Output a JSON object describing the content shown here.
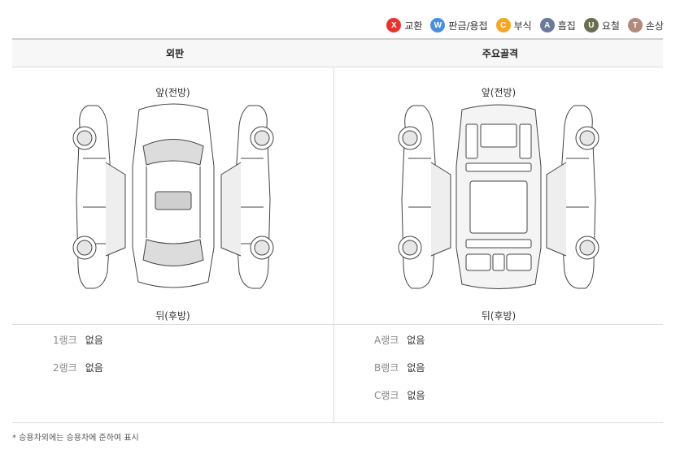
{
  "legend": [
    {
      "code": "X",
      "label": "교환",
      "color": "#e8342f",
      "icon": "x-badge-icon"
    },
    {
      "code": "W",
      "label": "판금/용접",
      "color": "#4a90d9",
      "icon": "w-badge-icon"
    },
    {
      "code": "C",
      "label": "부식",
      "color": "#f5a623",
      "icon": "c-badge-icon"
    },
    {
      "code": "A",
      "label": "흠집",
      "color": "#6b7a99",
      "icon": "a-badge-icon"
    },
    {
      "code": "U",
      "label": "요철",
      "color": "#6b6e4e",
      "icon": "u-badge-icon"
    },
    {
      "code": "T",
      "label": "손상",
      "color": "#b08a7a",
      "icon": "t-badge-icon"
    }
  ],
  "header": {
    "exterior": "외판",
    "frame": "주요골격"
  },
  "exterior": {
    "front": "앞(전방)",
    "rear": "뒤(후방)"
  },
  "frame": {
    "front": "앞(전방)",
    "rear": "뒤(후방)"
  },
  "exterior_ranks": [
    {
      "name": "1랭크",
      "value": "없음"
    },
    {
      "name": "2랭크",
      "value": "없음"
    }
  ],
  "frame_ranks": [
    {
      "name": "A랭크",
      "value": "없음"
    },
    {
      "name": "B랭크",
      "value": "없음"
    },
    {
      "name": "C랭크",
      "value": "없음"
    }
  ],
  "footnote": "* 승용차외에는 승용차에 준하여 표시"
}
